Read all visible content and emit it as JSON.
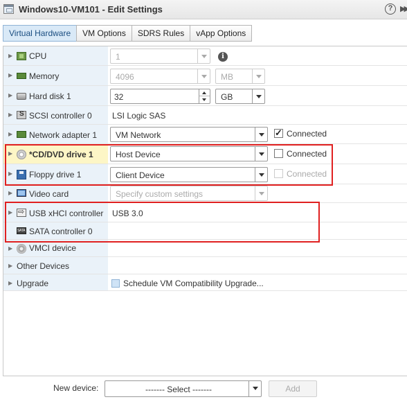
{
  "window": {
    "title": "Windows10-VM101 - Edit Settings",
    "help": "?"
  },
  "tabs": [
    {
      "label": "Virtual Hardware",
      "active": true
    },
    {
      "label": "VM Options"
    },
    {
      "label": "SDRS Rules"
    },
    {
      "label": "vApp Options"
    }
  ],
  "hardware": {
    "cpu": {
      "label": "CPU",
      "value": "1"
    },
    "memory": {
      "label": "Memory",
      "value": "4096",
      "unit": "MB"
    },
    "hard_disk": {
      "label": "Hard disk 1",
      "value": "32",
      "unit": "GB"
    },
    "scsi": {
      "label": "SCSI controller 0",
      "value": "LSI Logic SAS"
    },
    "network": {
      "label": "Network adapter 1",
      "value": "VM Network",
      "connected_label": "Connected",
      "connected": true
    },
    "cd_dvd": {
      "label": "*CD/DVD drive 1",
      "value": "Host Device",
      "connected_label": "Connected",
      "connected": false
    },
    "floppy": {
      "label": "Floppy drive 1",
      "value": "Client Device",
      "connected_label": "Connected",
      "connected": false
    },
    "video": {
      "label": "Video card",
      "value": "Specify custom settings"
    },
    "usb": {
      "label": "USB xHCI controller",
      "value": "USB 3.0"
    },
    "sata": {
      "label": "SATA controller 0",
      "value": ""
    },
    "vmci": {
      "label": "VMCI device"
    },
    "other": {
      "label": "Other Devices"
    },
    "upgrade": {
      "label": "Upgrade",
      "value": "Schedule VM Compatibility Upgrade..."
    }
  },
  "footer": {
    "new_device_label": "New device:",
    "select_value": "------- Select -------",
    "add_label": "Add"
  },
  "colors": {
    "highlight": "#e02020",
    "tab_active": "#d9e9f7",
    "label_bg": "#eaf2f9"
  },
  "icons": [
    "cpu-icon",
    "memory-icon",
    "hard-disk-icon",
    "scsi-icon",
    "network-icon",
    "cd-dvd-icon",
    "floppy-icon",
    "video-card-icon",
    "usb-icon",
    "sata-icon",
    "vmci-icon",
    "info-icon",
    "help-icon"
  ]
}
